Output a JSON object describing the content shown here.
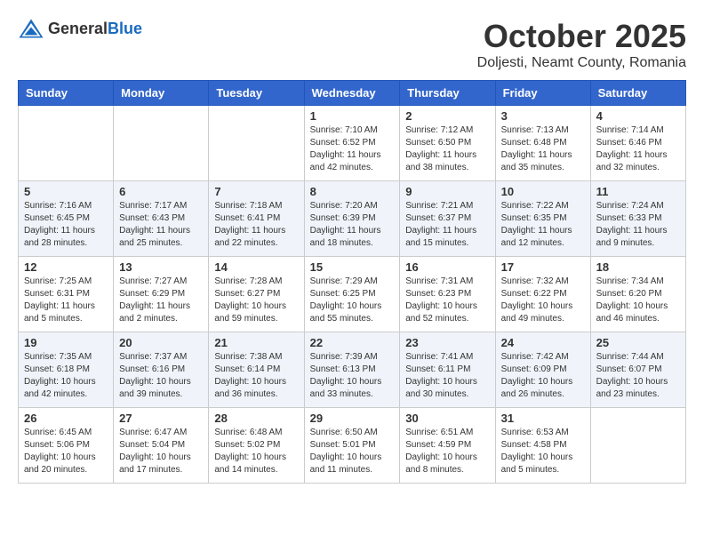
{
  "logo": {
    "text_general": "General",
    "text_blue": "Blue"
  },
  "title": {
    "month": "October 2025",
    "location": "Doljesti, Neamt County, Romania"
  },
  "days_of_week": [
    "Sunday",
    "Monday",
    "Tuesday",
    "Wednesday",
    "Thursday",
    "Friday",
    "Saturday"
  ],
  "weeks": [
    [
      {
        "day": "",
        "info": ""
      },
      {
        "day": "",
        "info": ""
      },
      {
        "day": "",
        "info": ""
      },
      {
        "day": "1",
        "info": "Sunrise: 7:10 AM\nSunset: 6:52 PM\nDaylight: 11 hours and 42 minutes."
      },
      {
        "day": "2",
        "info": "Sunrise: 7:12 AM\nSunset: 6:50 PM\nDaylight: 11 hours and 38 minutes."
      },
      {
        "day": "3",
        "info": "Sunrise: 7:13 AM\nSunset: 6:48 PM\nDaylight: 11 hours and 35 minutes."
      },
      {
        "day": "4",
        "info": "Sunrise: 7:14 AM\nSunset: 6:46 PM\nDaylight: 11 hours and 32 minutes."
      }
    ],
    [
      {
        "day": "5",
        "info": "Sunrise: 7:16 AM\nSunset: 6:45 PM\nDaylight: 11 hours and 28 minutes."
      },
      {
        "day": "6",
        "info": "Sunrise: 7:17 AM\nSunset: 6:43 PM\nDaylight: 11 hours and 25 minutes."
      },
      {
        "day": "7",
        "info": "Sunrise: 7:18 AM\nSunset: 6:41 PM\nDaylight: 11 hours and 22 minutes."
      },
      {
        "day": "8",
        "info": "Sunrise: 7:20 AM\nSunset: 6:39 PM\nDaylight: 11 hours and 18 minutes."
      },
      {
        "day": "9",
        "info": "Sunrise: 7:21 AM\nSunset: 6:37 PM\nDaylight: 11 hours and 15 minutes."
      },
      {
        "day": "10",
        "info": "Sunrise: 7:22 AM\nSunset: 6:35 PM\nDaylight: 11 hours and 12 minutes."
      },
      {
        "day": "11",
        "info": "Sunrise: 7:24 AM\nSunset: 6:33 PM\nDaylight: 11 hours and 9 minutes."
      }
    ],
    [
      {
        "day": "12",
        "info": "Sunrise: 7:25 AM\nSunset: 6:31 PM\nDaylight: 11 hours and 5 minutes."
      },
      {
        "day": "13",
        "info": "Sunrise: 7:27 AM\nSunset: 6:29 PM\nDaylight: 11 hours and 2 minutes."
      },
      {
        "day": "14",
        "info": "Sunrise: 7:28 AM\nSunset: 6:27 PM\nDaylight: 10 hours and 59 minutes."
      },
      {
        "day": "15",
        "info": "Sunrise: 7:29 AM\nSunset: 6:25 PM\nDaylight: 10 hours and 55 minutes."
      },
      {
        "day": "16",
        "info": "Sunrise: 7:31 AM\nSunset: 6:23 PM\nDaylight: 10 hours and 52 minutes."
      },
      {
        "day": "17",
        "info": "Sunrise: 7:32 AM\nSunset: 6:22 PM\nDaylight: 10 hours and 49 minutes."
      },
      {
        "day": "18",
        "info": "Sunrise: 7:34 AM\nSunset: 6:20 PM\nDaylight: 10 hours and 46 minutes."
      }
    ],
    [
      {
        "day": "19",
        "info": "Sunrise: 7:35 AM\nSunset: 6:18 PM\nDaylight: 10 hours and 42 minutes."
      },
      {
        "day": "20",
        "info": "Sunrise: 7:37 AM\nSunset: 6:16 PM\nDaylight: 10 hours and 39 minutes."
      },
      {
        "day": "21",
        "info": "Sunrise: 7:38 AM\nSunset: 6:14 PM\nDaylight: 10 hours and 36 minutes."
      },
      {
        "day": "22",
        "info": "Sunrise: 7:39 AM\nSunset: 6:13 PM\nDaylight: 10 hours and 33 minutes."
      },
      {
        "day": "23",
        "info": "Sunrise: 7:41 AM\nSunset: 6:11 PM\nDaylight: 10 hours and 30 minutes."
      },
      {
        "day": "24",
        "info": "Sunrise: 7:42 AM\nSunset: 6:09 PM\nDaylight: 10 hours and 26 minutes."
      },
      {
        "day": "25",
        "info": "Sunrise: 7:44 AM\nSunset: 6:07 PM\nDaylight: 10 hours and 23 minutes."
      }
    ],
    [
      {
        "day": "26",
        "info": "Sunrise: 6:45 AM\nSunset: 5:06 PM\nDaylight: 10 hours and 20 minutes."
      },
      {
        "day": "27",
        "info": "Sunrise: 6:47 AM\nSunset: 5:04 PM\nDaylight: 10 hours and 17 minutes."
      },
      {
        "day": "28",
        "info": "Sunrise: 6:48 AM\nSunset: 5:02 PM\nDaylight: 10 hours and 14 minutes."
      },
      {
        "day": "29",
        "info": "Sunrise: 6:50 AM\nSunset: 5:01 PM\nDaylight: 10 hours and 11 minutes."
      },
      {
        "day": "30",
        "info": "Sunrise: 6:51 AM\nSunset: 4:59 PM\nDaylight: 10 hours and 8 minutes."
      },
      {
        "day": "31",
        "info": "Sunrise: 6:53 AM\nSunset: 4:58 PM\nDaylight: 10 hours and 5 minutes."
      },
      {
        "day": "",
        "info": ""
      }
    ]
  ]
}
